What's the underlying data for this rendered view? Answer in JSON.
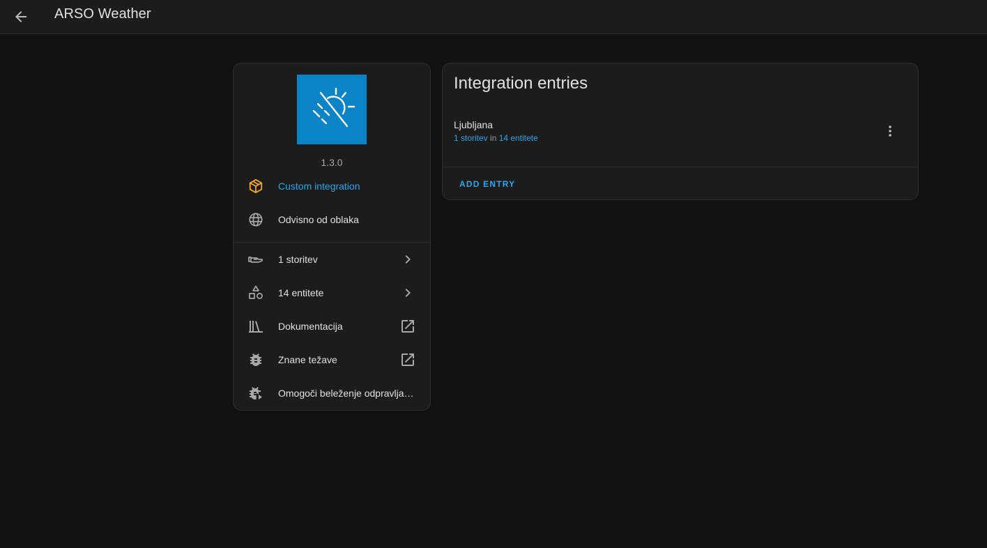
{
  "header": {
    "title": "ARSO Weather",
    "back_icon": "arrow-left-icon"
  },
  "info": {
    "logo_icon": "weather-sunny-off-icon",
    "logo_color": "#0a84c6",
    "version": "1.3.0",
    "items": [
      {
        "label": "Custom integration",
        "icon": "package-variant-icon",
        "accent": "#f5a623",
        "link_color": "#2ea6e8"
      },
      {
        "label": "Odvisno od oblaka",
        "icon": "web-icon"
      },
      {
        "label": "1 storitev",
        "icon": "device-hub-icon",
        "trailing": "chevron-right-icon"
      },
      {
        "label": "14 entitete",
        "icon": "shape-outline-icon",
        "trailing": "chevron-right-icon"
      },
      {
        "label": "Dokumentacija",
        "icon": "bookshelf-icon",
        "trailing": "open-in-new-icon"
      },
      {
        "label": "Znane težave",
        "icon": "bug-icon",
        "trailing": "open-in-new-icon"
      },
      {
        "label": "Omogoči beleženje odpravljanja napak",
        "icon": "bug-play-icon"
      }
    ]
  },
  "entries": {
    "title": "Integration entries",
    "items": [
      {
        "name": "Ljubljana",
        "services_link": "1 storitev",
        "joiner": " in ",
        "entities_link": "14 entitete"
      }
    ],
    "add_label": "ADD ENTRY"
  }
}
